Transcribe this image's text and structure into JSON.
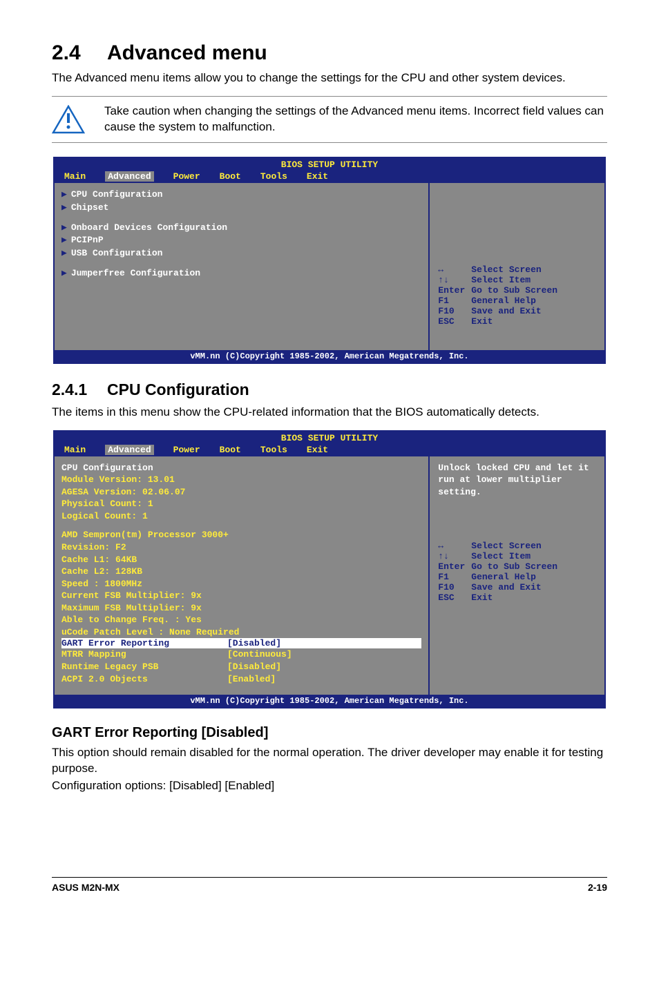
{
  "section": {
    "num": "2.4",
    "title": "Advanced menu"
  },
  "intro": "The Advanced menu items allow you to change the settings for the CPU and other system devices.",
  "warning": "Take caution when changing the settings of the Advanced menu items. Incorrect field values can cause the system to malfunction.",
  "bios1": {
    "title": "BIOS SETUP UTILITY",
    "tabs": [
      "Main",
      "Advanced",
      "Power",
      "Boot",
      "Tools",
      "Exit"
    ],
    "items": [
      "CPU Configuration",
      "Chipset",
      "Onboard Devices Configuration",
      "PCIPnP",
      "USB Configuration",
      "Jumperfree Configuration"
    ],
    "keys": [
      {
        "k": "↔",
        "d": "Select Screen"
      },
      {
        "k": "↑↓",
        "d": "Select Item"
      },
      {
        "k": "Enter",
        "d": "Go to Sub Screen"
      },
      {
        "k": "F1",
        "d": "General Help"
      },
      {
        "k": "F10",
        "d": "Save and Exit"
      },
      {
        "k": "ESC",
        "d": "Exit"
      }
    ],
    "footer": "vMM.nn (C)Copyright 1985-2002, American Megatrends, Inc."
  },
  "sub1": {
    "num": "2.4.1",
    "title": "CPU Configuration"
  },
  "sub1_intro": "The items in this menu show the CPU-related information that the BIOS automatically detects.",
  "bios2": {
    "title": "BIOS SETUP UTILITY",
    "tabs": [
      "Main",
      "Advanced",
      "Power",
      "Boot",
      "Tools",
      "Exit"
    ],
    "header": [
      "CPU Configuration",
      "Module Version: 13.01",
      "AGESA Version: 02.06.07",
      "Physical Count: 1",
      "Logical Count: 1"
    ],
    "info": [
      "AMD Sempron(tm) Processor 3000+",
      "Revision: F2",
      "Cache L1: 64KB",
      "Cache L2: 128KB",
      "Speed   : 1800MHz",
      "Current FSB Multiplier: 9x",
      "Maximum FSB Multiplier: 9x",
      "Able to Change Freq.   : Yes",
      "uCode Patch Level     : None Required"
    ],
    "opts": [
      {
        "lbl": "GART Error Reporting",
        "val": "[Disabled]",
        "hi": true
      },
      {
        "lbl": "MTRR Mapping",
        "val": "[Continuous]"
      },
      {
        "lbl": "Runtime Legacy PSB",
        "val": "[Disabled]"
      },
      {
        "lbl": "ACPI 2.0 Objects",
        "val": "[Enabled]"
      }
    ],
    "help": "Unlock locked CPU and let it run at lower multiplier setting.",
    "keys": [
      {
        "k": "↔",
        "d": "Select Screen"
      },
      {
        "k": "↑↓",
        "d": "Select Item"
      },
      {
        "k": "Enter",
        "d": "Go to Sub Screen"
      },
      {
        "k": "F1",
        "d": "General Help"
      },
      {
        "k": "F10",
        "d": "Save and Exit"
      },
      {
        "k": "ESC",
        "d": "Exit"
      }
    ],
    "footer": "vMM.nn (C)Copyright 1985-2002, American Megatrends, Inc."
  },
  "gart": {
    "title": "GART Error Reporting [Disabled]",
    "body1": "This option should remain disabled for the normal operation. The driver developer may enable it for testing purpose.",
    "body2": "Configuration options: [Disabled] [Enabled]"
  },
  "foot": {
    "left": "ASUS M2N-MX",
    "right": "2-19"
  }
}
